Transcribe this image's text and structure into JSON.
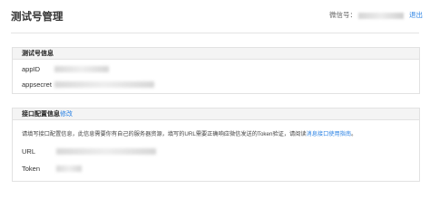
{
  "header": {
    "title": "测试号管理",
    "account_label": "微信号：",
    "logout_label": "退出"
  },
  "test_account_info": {
    "heading": "测试号信息",
    "fields": [
      {
        "label": "appID"
      },
      {
        "label": "appsecret"
      }
    ]
  },
  "interface_config": {
    "heading": "接口配置信息",
    "edit_label": "修改",
    "description": "请填写接口配置信息，此信息需要你有自己的服务器资源，填写的URL需要正确响应微信发送的Token验证，请阅读",
    "doc_link": "消息接口使用指南",
    "description_end": "。",
    "fields": [
      {
        "label": "URL"
      },
      {
        "label": "Token"
      }
    ]
  }
}
